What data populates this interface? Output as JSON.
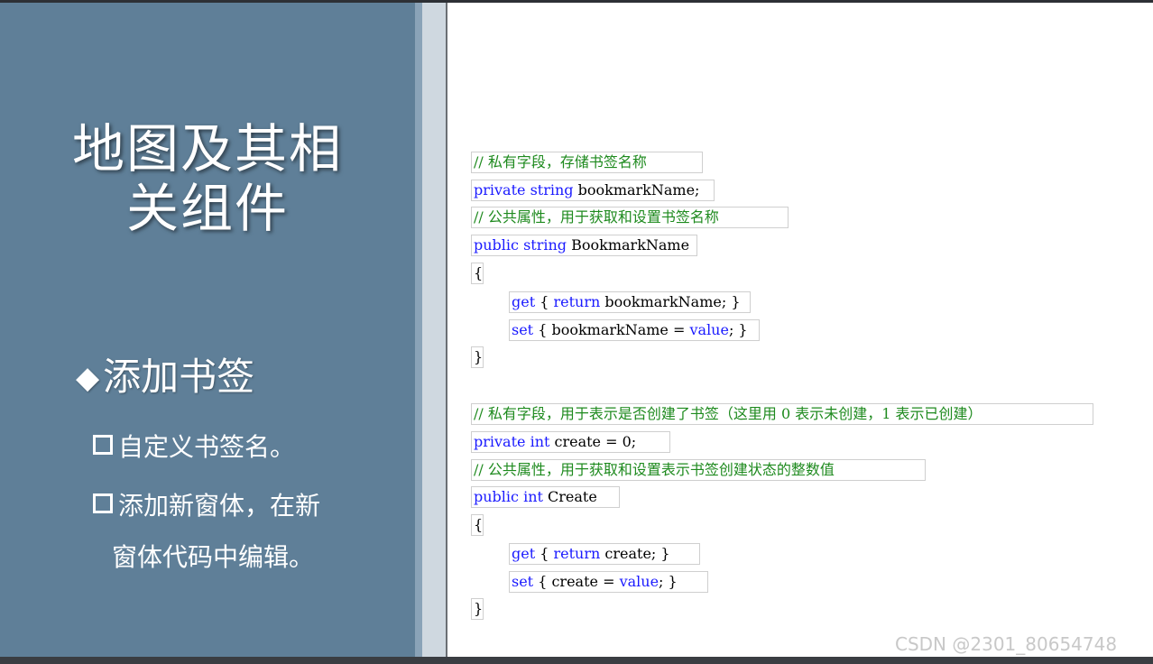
{
  "slide": {
    "title_line1": "地图及其相",
    "title_line2": "关组件",
    "bullet_symbol": "◆",
    "bullet_heading": "添加书签",
    "sub_items": [
      "自定义书签名。",
      "添加新窗体，在新",
      "窗体代码中编辑。"
    ]
  },
  "code": {
    "l1": "// 私有字段，存储书签名称",
    "l2_kw": "private string",
    "l2_rest": " bookmarkName;",
    "l3": "// 公共属性，用于获取和设置书签名称",
    "l4_kw": "public string",
    "l4_rest": " BookmarkName",
    "l5": "{",
    "l6_kw": "get",
    "l6_mid": " { ",
    "l6_kw2": "return",
    "l6_rest": " bookmarkName; }",
    "l7_kw": "set",
    "l7_mid": " { bookmarkName = ",
    "l7_kw2": "value",
    "l7_rest": "; }",
    "l8": "}",
    "l9": "// 私有字段，用于表示是否创建了书签（这里用 0 表示未创建，1 表示已创建）",
    "l10_kw": "private int",
    "l10_rest": " create = 0;",
    "l11": "// 公共属性，用于获取和设置表示书签创建状态的整数值",
    "l12_kw": "public int",
    "l12_rest": " Create",
    "l13": "{",
    "l14_kw": "get",
    "l14_mid": " { ",
    "l14_kw2": "return",
    "l14_rest": " create; }",
    "l15_kw": "set",
    "l15_mid": " { create = ",
    "l15_kw2": "value",
    "l15_rest": "; }",
    "l16": "}"
  },
  "watermark": "CSDN @2301_80654748",
  "colors": {
    "left_panel": "#5f7f98",
    "comment": "#1e8a1e",
    "keyword": "#1a1aff"
  }
}
